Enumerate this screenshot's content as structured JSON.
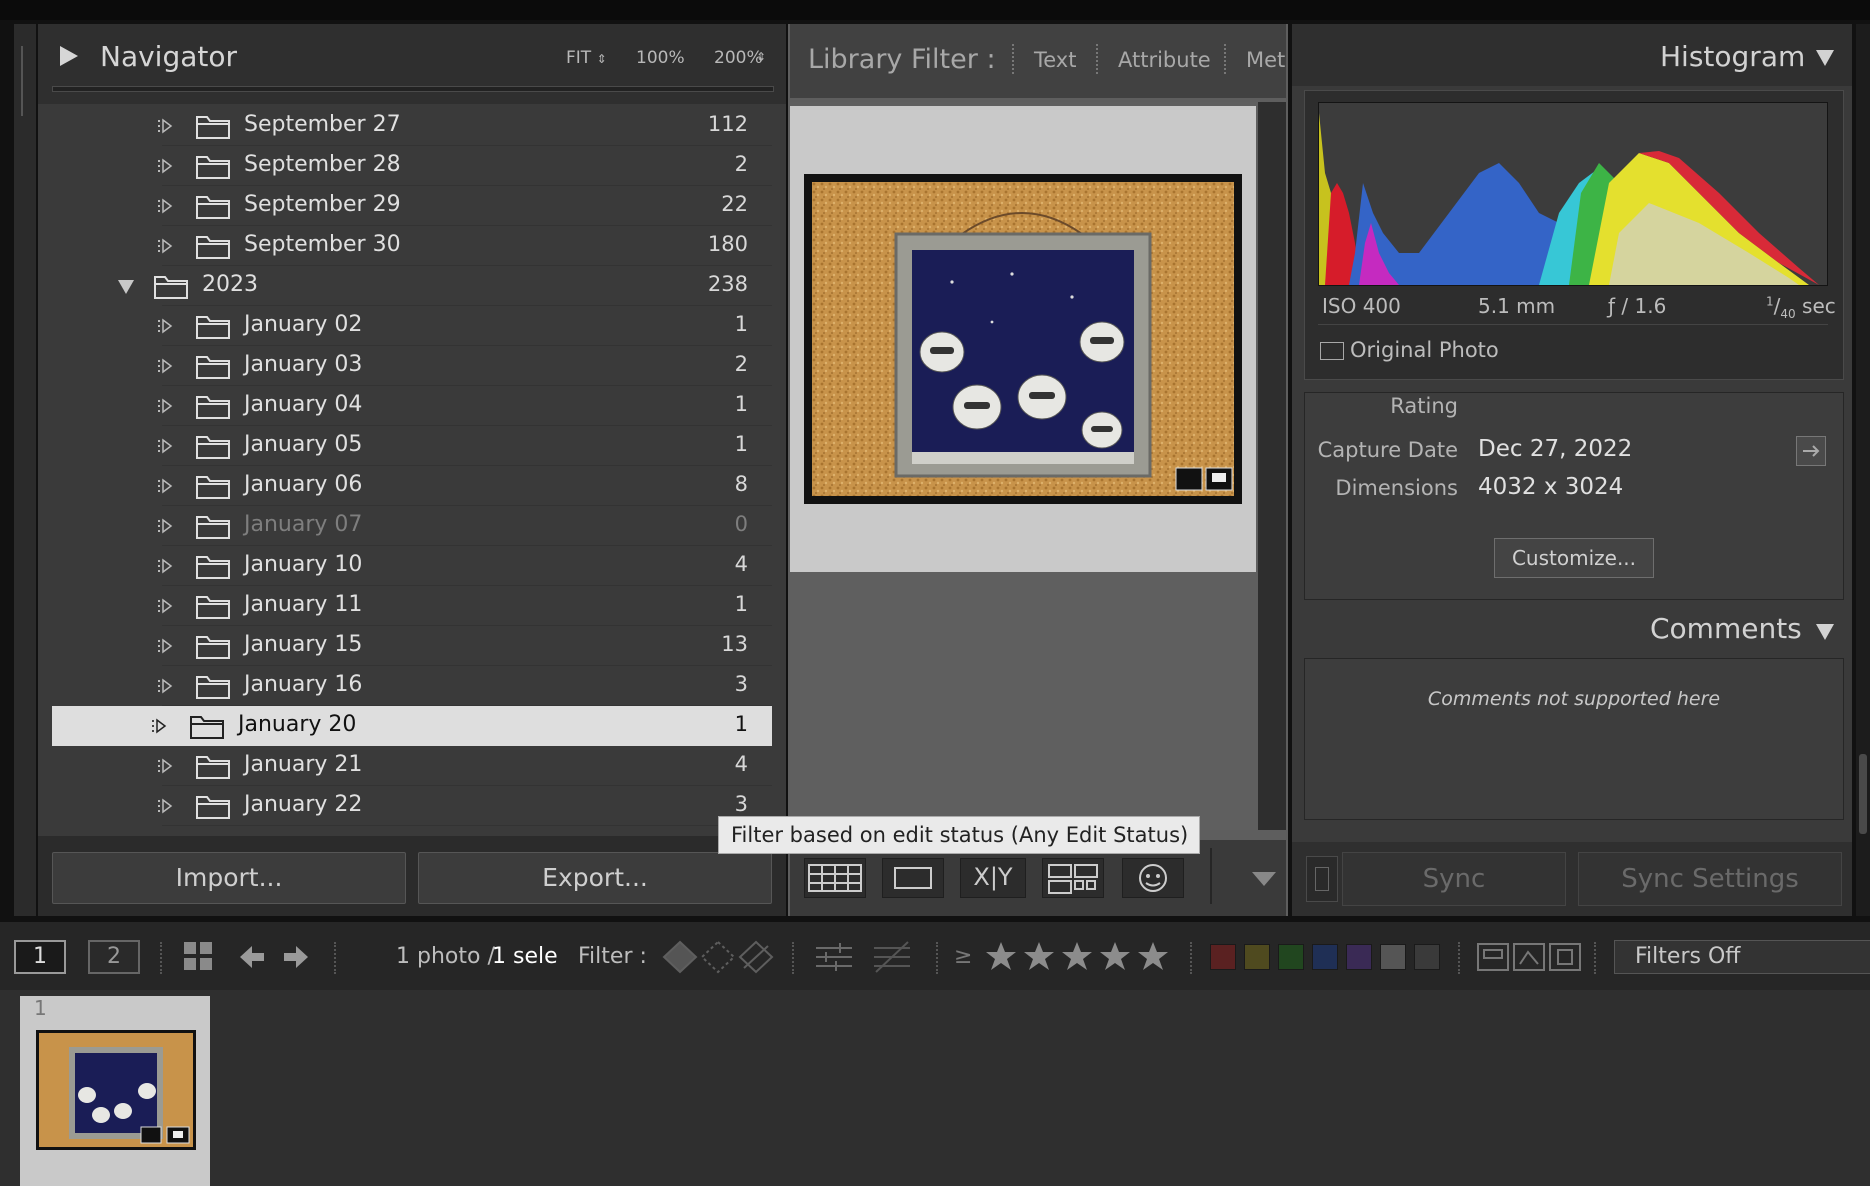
{
  "navigator": {
    "title": "Navigator",
    "zoom_fit": "FIT",
    "zoom_100": "100%",
    "zoom_200": "200%"
  },
  "folders": [
    {
      "name": "September 27",
      "count": "112",
      "type": "day"
    },
    {
      "name": "September 28",
      "count": "2",
      "type": "day"
    },
    {
      "name": "September 29",
      "count": "22",
      "type": "day"
    },
    {
      "name": "September 30",
      "count": "180",
      "type": "day"
    },
    {
      "name": "2023",
      "count": "238",
      "type": "year"
    },
    {
      "name": "January 02",
      "count": "1",
      "type": "day"
    },
    {
      "name": "January 03",
      "count": "2",
      "type": "day"
    },
    {
      "name": "January 04",
      "count": "1",
      "type": "day"
    },
    {
      "name": "January 05",
      "count": "1",
      "type": "day"
    },
    {
      "name": "January 06",
      "count": "8",
      "type": "day"
    },
    {
      "name": "January 07",
      "count": "0",
      "type": "day",
      "dim": true
    },
    {
      "name": "January 10",
      "count": "4",
      "type": "day"
    },
    {
      "name": "January 11",
      "count": "1",
      "type": "day"
    },
    {
      "name": "January 15",
      "count": "13",
      "type": "day"
    },
    {
      "name": "January 16",
      "count": "3",
      "type": "day"
    },
    {
      "name": "January 20",
      "count": "1",
      "type": "day",
      "selected": true
    },
    {
      "name": "January 21",
      "count": "4",
      "type": "day"
    },
    {
      "name": "January 22",
      "count": "3",
      "type": "day"
    }
  ],
  "buttons": {
    "import": "Import...",
    "export": "Export..."
  },
  "library_filter": {
    "title": "Library Filter :",
    "text": "Text",
    "attribute": "Attribute",
    "metadata": "Met"
  },
  "tooltip": "Filter based on edit status (Any Edit Status)",
  "toolbar": {
    "compare_label": "X|Y"
  },
  "histogram": {
    "title": "Histogram",
    "iso": "ISO 400",
    "focal": "5.1 mm",
    "aperture": "ƒ / 1.6",
    "shutter_num": "1",
    "shutter_den": "40",
    "shutter_unit": "sec",
    "original_photo": "Original Photo"
  },
  "metadata": {
    "rating_label": "Rating",
    "capture_date_label": "Capture Date",
    "capture_date": "Dec 27, 2022",
    "dimensions_label": "Dimensions",
    "dimensions": "4032 x 3024",
    "customize": "Customize..."
  },
  "comments": {
    "title": "Comments",
    "empty_text": "Comments not supported here"
  },
  "sync": {
    "sync": "Sync",
    "sync_settings": "Sync Settings"
  },
  "filmstrip": {
    "page1": "1",
    "page2": "2",
    "photo_count": "1 photo /",
    "selected_text": "1 selec",
    "filter_label": "Filter :",
    "gte": "≥",
    "filters_off": "Filters Off",
    "cell_number": "1"
  },
  "colors": {
    "label_red": "#5a2121",
    "label_yellow": "#4f4a1f",
    "label_green": "#21461f",
    "label_blue": "#1f2f55",
    "label_purple": "#3a2a55",
    "label_gray1": "#555555",
    "label_gray2": "#3a3a3a"
  }
}
